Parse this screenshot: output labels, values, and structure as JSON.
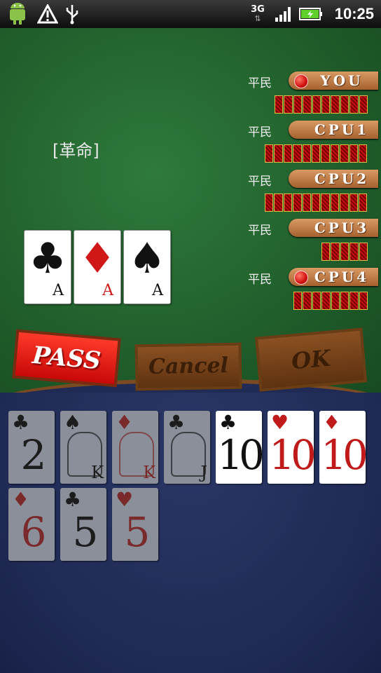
{
  "status_bar": {
    "icons": [
      "android-icon",
      "warning-icon",
      "usb-icon",
      "3g-icon",
      "signal-icon",
      "battery-icon"
    ],
    "network_label": "3G",
    "time": "10:25"
  },
  "table": {
    "revolution_label": "[革命]",
    "players": [
      {
        "rank": "平民",
        "name": "YOU",
        "active": true,
        "cards": 10
      },
      {
        "rank": "平民",
        "name": "CPU1",
        "active": false,
        "cards": 11
      },
      {
        "rank": "平民",
        "name": "CPU2",
        "active": false,
        "cards": 11
      },
      {
        "rank": "平民",
        "name": "CPU3",
        "active": false,
        "cards": 5
      },
      {
        "rank": "平民",
        "name": "CPU4",
        "active": true,
        "cards": 8
      }
    ],
    "played_cards": [
      {
        "suit": "♣",
        "rank": "A",
        "color": "black"
      },
      {
        "suit": "♦",
        "rank": "A",
        "color": "red"
      },
      {
        "suit": "♠",
        "rank": "A",
        "color": "black"
      }
    ]
  },
  "buttons": {
    "pass": "PASS",
    "cancel": "Cancel",
    "ok": "OK"
  },
  "hand": [
    {
      "suit": "♣",
      "rank": "2",
      "color": "black",
      "dim": true
    },
    {
      "suit": "♠",
      "rank": "K",
      "color": "black",
      "dim": true,
      "face": true
    },
    {
      "suit": "♦",
      "rank": "K",
      "color": "red",
      "dim": true,
      "face": true
    },
    {
      "suit": "♣",
      "rank": "J",
      "color": "black",
      "dim": true,
      "face": true
    },
    {
      "suit": "♣",
      "rank": "10",
      "color": "black",
      "dim": false
    },
    {
      "suit": "♥",
      "rank": "10",
      "color": "red",
      "dim": false
    },
    {
      "suit": "♦",
      "rank": "10",
      "color": "red",
      "dim": false
    },
    {
      "suit": "♦",
      "rank": "6",
      "color": "red",
      "dim": true
    },
    {
      "suit": "♣",
      "rank": "5",
      "color": "black",
      "dim": true
    },
    {
      "suit": "♥",
      "rank": "5",
      "color": "red",
      "dim": true
    }
  ]
}
